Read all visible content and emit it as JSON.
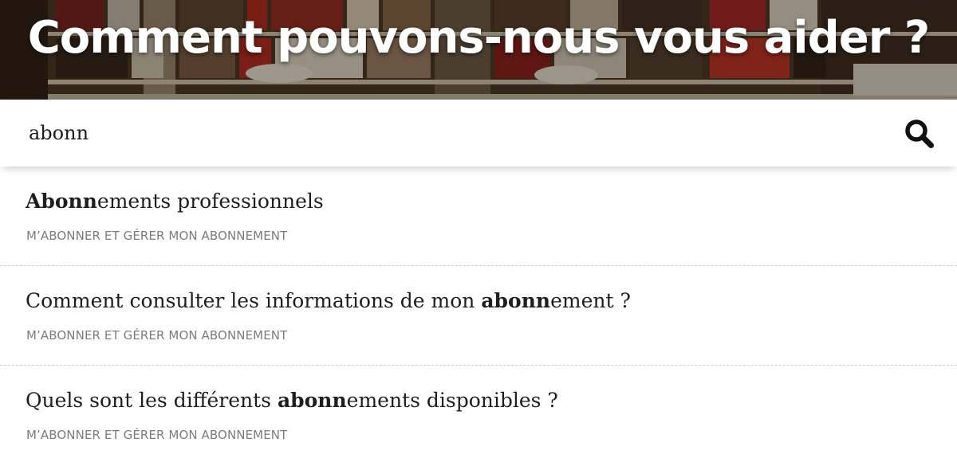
{
  "hero": {
    "title": "Comment pouvons-nous vous aider ?"
  },
  "search": {
    "value": "abonn",
    "icon": "search-icon"
  },
  "results": [
    {
      "title_highlight": "Abonn",
      "title_before": "",
      "title_after": "ements professionnels",
      "category": "M’ABONNER ET GÉRER MON ABONNEMENT"
    },
    {
      "title_before": "Comment consulter les informations de mon ",
      "title_highlight": "abonn",
      "title_after": "ement ?",
      "category": "M’ABONNER ET GÉRER MON ABONNEMENT"
    },
    {
      "title_before": "Quels sont les différents ",
      "title_highlight": "abonn",
      "title_after": "ements disponibles ?",
      "category": "M’ABONNER ET GÉRER MON ABONNEMENT"
    }
  ],
  "colors": {
    "hero_text": "#ffffff",
    "title_text": "#1e1e1e",
    "category_text": "#7c7c7c",
    "divider": "#cfcfcf"
  }
}
